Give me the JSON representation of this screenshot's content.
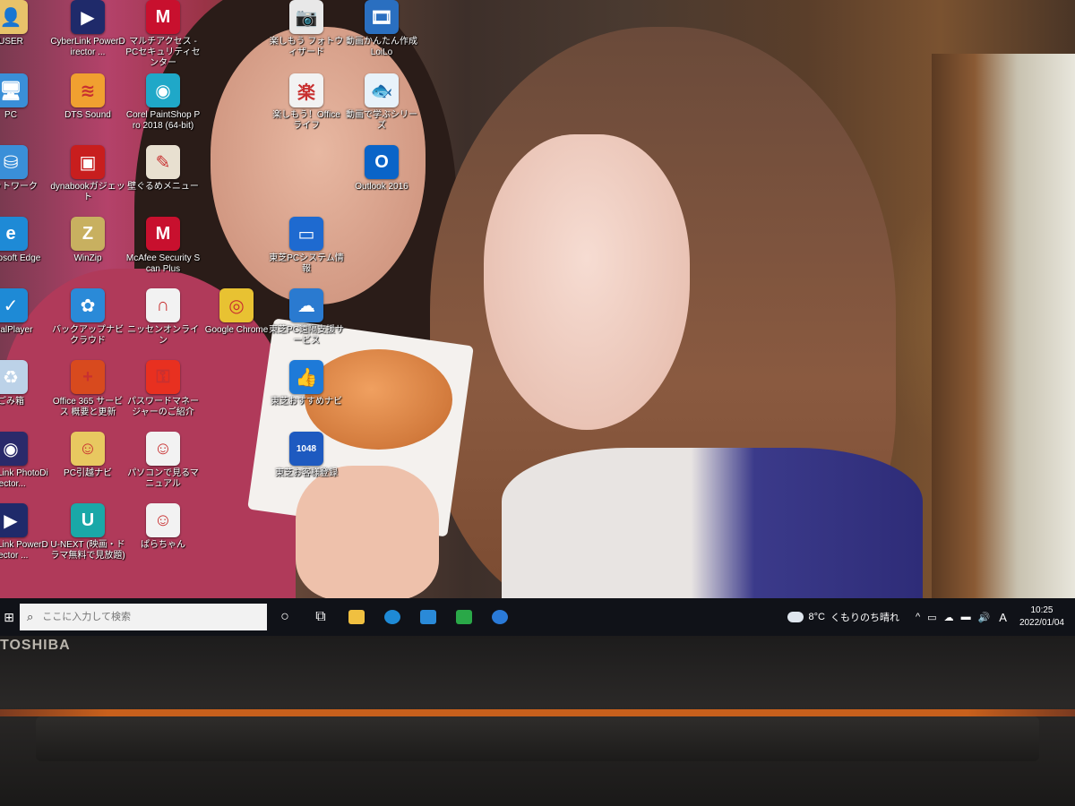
{
  "desktop": {
    "icons": [
      {
        "label": "USER",
        "glyph": "folder-user-icon",
        "color": "#e8c26a",
        "symbol": "👤"
      },
      {
        "label": "CyberLink PowerDirector ...",
        "glyph": "powerdirector-icon",
        "color": "#1f2a6a",
        "symbol": "▶"
      },
      {
        "label": "マルチアクセス - PCセキュリティセンター",
        "glyph": "mcafee-shield-icon",
        "color": "#c8102e",
        "symbol": "M"
      },
      {
        "label": "楽しもう フォトウィザード",
        "glyph": "photo-wizard-icon",
        "color": "#e8e8e8",
        "symbol": "📷"
      },
      {
        "label": "動画かんたん作成 LoiLo",
        "glyph": "loilo-icon",
        "color": "#2a6fc0",
        "symbol": "🎞"
      },
      {
        "label": "PC",
        "glyph": "pc-monitor-icon",
        "color": "#3a8fd8",
        "symbol": "🖥"
      },
      {
        "label": "DTS Sound",
        "glyph": "dts-sound-icon",
        "color": "#f0a030",
        "symbol": "≋"
      },
      {
        "label": "Corel PaintShop Pro 2018 (64-bit)",
        "glyph": "paintshop-camera-icon",
        "color": "#1fa8c8",
        "symbol": "◉"
      },
      {
        "label": "楽しもう！Officeライフ",
        "glyph": "office-life-icon",
        "color": "#f2f2f2",
        "symbol": "楽"
      },
      {
        "label": "動画で学ぶシリーズ",
        "glyph": "video-learning-icon",
        "color": "#e8f2fa",
        "symbol": "🐟"
      },
      {
        "label": "ネットワーク",
        "glyph": "network-icon",
        "color": "#3a8fd8",
        "symbol": "⛁"
      },
      {
        "label": "dynabookガジェット",
        "glyph": "dynabook-gadget-icon",
        "color": "#c81e1e",
        "symbol": "▣"
      },
      {
        "label": "壁ぐるめメニュー",
        "glyph": "gourmet-menu-icon",
        "color": "#e8e0d0",
        "symbol": "✎"
      },
      {
        "label": "Outlook 2016",
        "glyph": "outlook-icon",
        "color": "#0a64c8",
        "symbol": "O"
      },
      {
        "label": "Microsoft Edge",
        "glyph": "edge-icon",
        "color": "#1e8ad6",
        "symbol": "e"
      },
      {
        "label": "WinZip",
        "glyph": "winzip-icon",
        "color": "#c8b060",
        "symbol": "Z"
      },
      {
        "label": "McAfee Security Scan Plus",
        "glyph": "mcafee-scan-icon",
        "color": "#c8102e",
        "symbol": "M"
      },
      {
        "label": "東芝PCシステム情報",
        "glyph": "pc-system-info-icon",
        "color": "#1e6ad0",
        "symbol": "▭"
      },
      {
        "label": "RealPlayer",
        "glyph": "realplayer-icon",
        "color": "#1e8ad6",
        "symbol": "✓"
      },
      {
        "label": "バックアップナビ クラウド",
        "glyph": "backup-navi-icon",
        "color": "#2a8ad8",
        "symbol": "✿"
      },
      {
        "label": "ニッセンオンライン",
        "glyph": "nissen-online-icon",
        "color": "#f2f2f2",
        "symbol": "∩"
      },
      {
        "label": "Google Chrome",
        "glyph": "chrome-icon",
        "color": "#e8c232",
        "symbol": "◎"
      },
      {
        "label": "東芝PC遠隔支援サービス",
        "glyph": "remote-support-icon",
        "color": "#2a7ad0",
        "symbol": "☁"
      },
      {
        "label": "ごみ箱",
        "glyph": "recycle-bin-icon",
        "color": "#bcd2e8",
        "symbol": "♻"
      },
      {
        "label": "Office 365 サービス 概要と更新",
        "glyph": "office365-icon",
        "color": "#d84a1e",
        "symbol": "+"
      },
      {
        "label": "パスワードマネージャーのご紹介",
        "glyph": "password-manager-icon",
        "color": "#e83020",
        "symbol": "⚿"
      },
      {
        "label": "東芝おすすめナビ",
        "glyph": "recommend-navi-icon",
        "color": "#1e7ad8",
        "symbol": "👍"
      },
      {
        "label": "CyberLink PhotoDirector...",
        "glyph": "photodirector-icon",
        "color": "#2a2a6a",
        "symbol": "◉"
      },
      {
        "label": "PC引越ナビ",
        "glyph": "pc-move-navi-icon",
        "color": "#e8c860",
        "symbol": "☺"
      },
      {
        "label": "パソコンで見るマニュアル",
        "glyph": "pc-manual-icon",
        "color": "#f2f2f2",
        "symbol": "☺"
      },
      {
        "label": "東芝お客様登録",
        "glyph": "customer-registration-icon",
        "color": "#1e5ac0",
        "symbol": "1048"
      },
      {
        "label": "CyberLink PowerDirector ...",
        "glyph": "powerdirector-icon",
        "color": "#1f2a6a",
        "symbol": "▶"
      },
      {
        "label": "U-NEXT (映画・ドラマ無料で見放題)",
        "glyph": "u-next-icon",
        "color": "#1aa8a8",
        "symbol": "U"
      },
      {
        "label": "ぱらちゃん",
        "glyph": "para-chan-icon",
        "color": "#f2f2f2",
        "symbol": "☺"
      }
    ]
  },
  "taskbar": {
    "start_symbol": "⊞",
    "search_placeholder": "ここに入力して検索",
    "search_symbol": "⌕",
    "cortana_symbol": "○",
    "taskview_symbol": "⧉",
    "apps": [
      {
        "name": "file-explorer-icon",
        "color": "#f0c040"
      },
      {
        "name": "edge-icon",
        "color": "#1e8ad6"
      },
      {
        "name": "microsoft-store-icon",
        "color": "#2a8ad8"
      },
      {
        "name": "green-app-icon",
        "color": "#2aa848"
      },
      {
        "name": "info-icon",
        "color": "#2a7ad8"
      }
    ],
    "weather": {
      "temp": "8°C",
      "desc": "くもりのち晴れ"
    },
    "tray_symbols": [
      "^",
      "▭",
      "☁",
      "▬",
      "🔊"
    ],
    "ime": "A",
    "time": "10:25",
    "date": "2022/01/04"
  },
  "laptop": {
    "brand": "TOSHIBA"
  }
}
